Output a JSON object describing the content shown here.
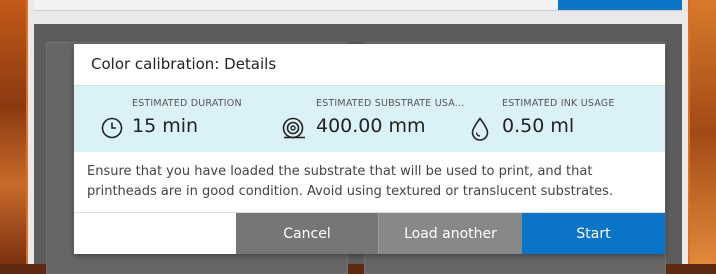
{
  "dialog": {
    "title": "Color calibration: Details",
    "estimates": [
      {
        "label": "ESTIMATED DURATION",
        "value": "15 min",
        "icon": "clock-icon"
      },
      {
        "label": "ESTIMATED SUBSTRATE USA...",
        "value": "400.00 mm",
        "icon": "substrate-roll-icon"
      },
      {
        "label": "ESTIMATED INK USAGE",
        "value": "0.50 ml",
        "icon": "ink-drop-icon"
      }
    ],
    "description": "Ensure that you have loaded the substrate that will be used to print, and that printheads are in good condition. Avoid using textured or translucent substrates.",
    "buttons": {
      "cancel": "Cancel",
      "load_another": "Load another",
      "start": "Start"
    }
  },
  "colors": {
    "accent": "#0a75c6",
    "estimates_bg": "#daf1f8",
    "cancel_bg": "#767676",
    "load_bg": "#888888"
  }
}
